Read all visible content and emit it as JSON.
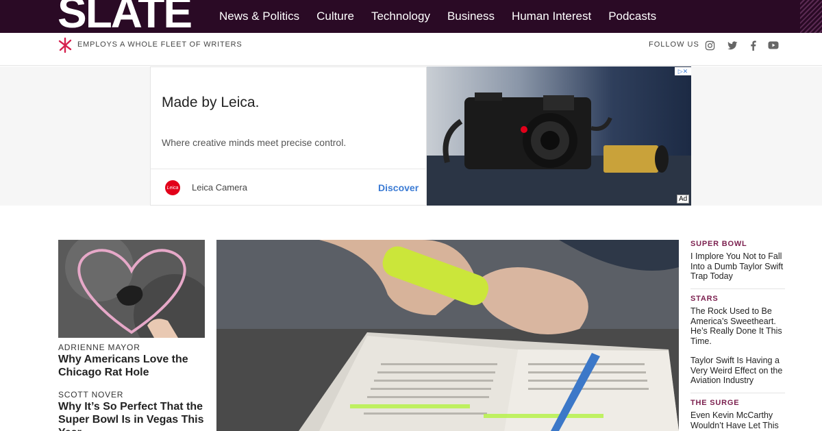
{
  "brand": {
    "logo": "SLATE"
  },
  "nav": [
    "News & Politics",
    "Culture",
    "Technology",
    "Business",
    "Human Interest",
    "Podcasts"
  ],
  "subbar": {
    "tagline": "EMPLOYS A WHOLE FLEET OF WRITERS",
    "follow_label": "FOLLOW US",
    "social_icons": [
      "instagram-icon",
      "twitter-icon",
      "facebook-icon",
      "youtube-icon"
    ]
  },
  "ad": {
    "title": "Made by Leica.",
    "description": "Where creative minds meet precise control.",
    "brand": "Leica Camera",
    "brand_logo_text": "Leica",
    "cta": "Discover",
    "badge": "Ad"
  },
  "left_stories": [
    {
      "author": "ADRIENNE MAYOR",
      "headline": "Why Americans Love the Chicago Rat Hole"
    },
    {
      "author": "SCOTT NOVER",
      "headline": "Why It’s So Perfect That the Super Bowl Is in Vegas This Year"
    }
  ],
  "right_rail": [
    {
      "kicker": "SUPER BOWL",
      "headline": "I Implore You Not to Fall Into a Dumb Taylor Swift Trap Today"
    },
    {
      "kicker": "STARS",
      "headline": "The Rock Used to Be America’s Sweetheart. He’s Really Done It This Time."
    },
    {
      "kicker": "",
      "headline": "Taylor Swift Is Having a Very Weird Effect on the Aviation Industry"
    },
    {
      "kicker": "THE SURGE",
      "headline": "Even Kevin McCarthy Wouldn’t Have Let This"
    }
  ]
}
